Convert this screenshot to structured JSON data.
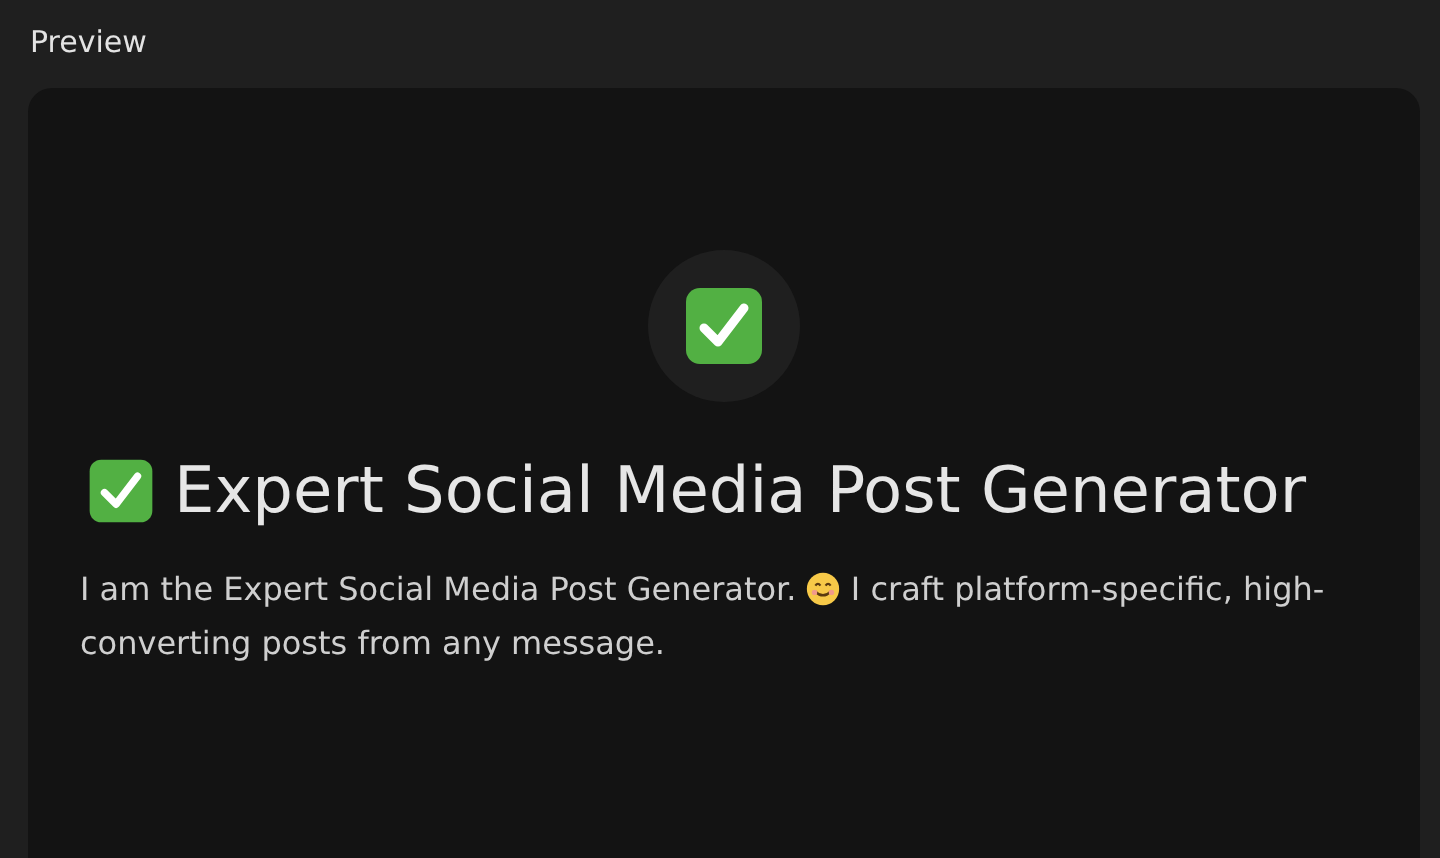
{
  "header": {
    "title": "Preview"
  },
  "preview": {
    "avatar": {
      "kind": "check"
    },
    "title": {
      "leading": {
        "kind": "check"
      },
      "text": "Expert Social Media Post Generator"
    },
    "description": [
      {
        "kind": "text",
        "text": "I am the Expert Social Media Post Generator."
      },
      {
        "kind": "smiley"
      },
      {
        "kind": "text",
        "text": "I craft platform-specific, high-"
      },
      {
        "kind": "break"
      },
      {
        "kind": "text",
        "text": "converting posts from any message."
      }
    ]
  }
}
